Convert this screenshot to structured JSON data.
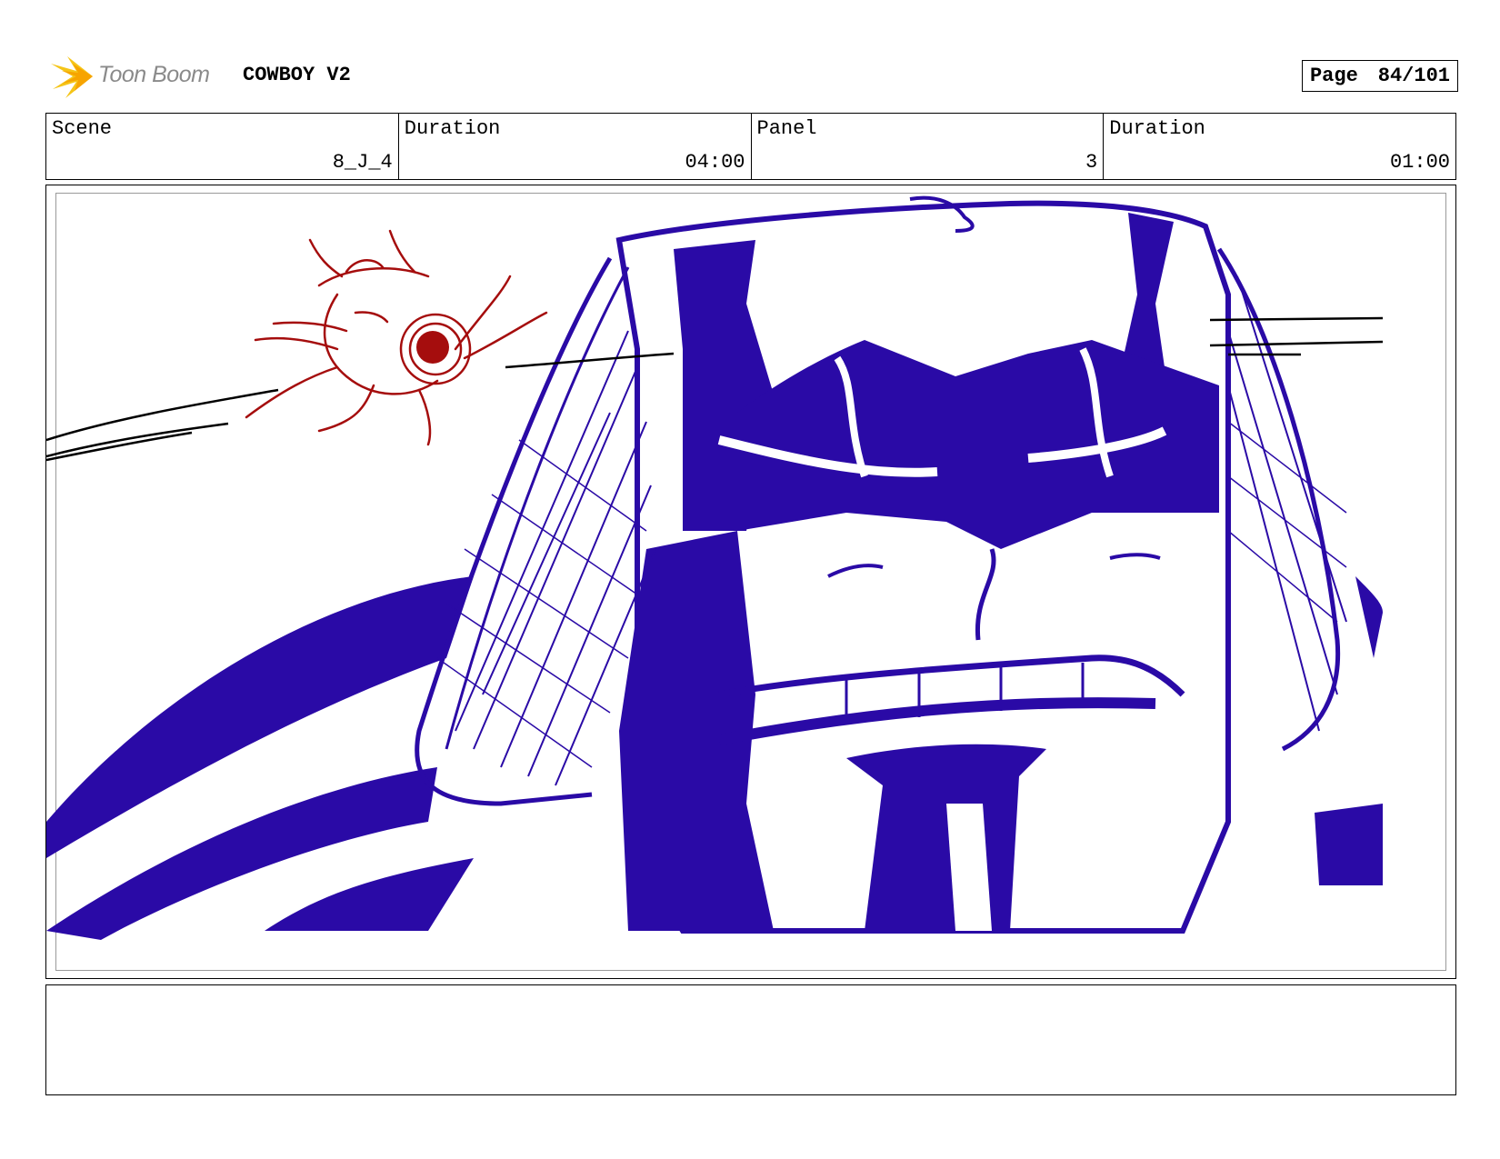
{
  "header": {
    "logo_text": "Toon Boom",
    "project_title": "COWBOY V2",
    "page_label": "Page",
    "page_value": "84/101"
  },
  "info": [
    {
      "label": "Scene",
      "value": "8_J_4"
    },
    {
      "label": "Duration",
      "value": "04:00"
    },
    {
      "label": "Panel",
      "value": "3"
    },
    {
      "label": "Duration",
      "value": "01:00"
    }
  ],
  "colors": {
    "sketch_blue": "#2a0aa6",
    "sketch_red": "#a50d0d",
    "logo_yellow": "#f5c518"
  },
  "notes": ""
}
